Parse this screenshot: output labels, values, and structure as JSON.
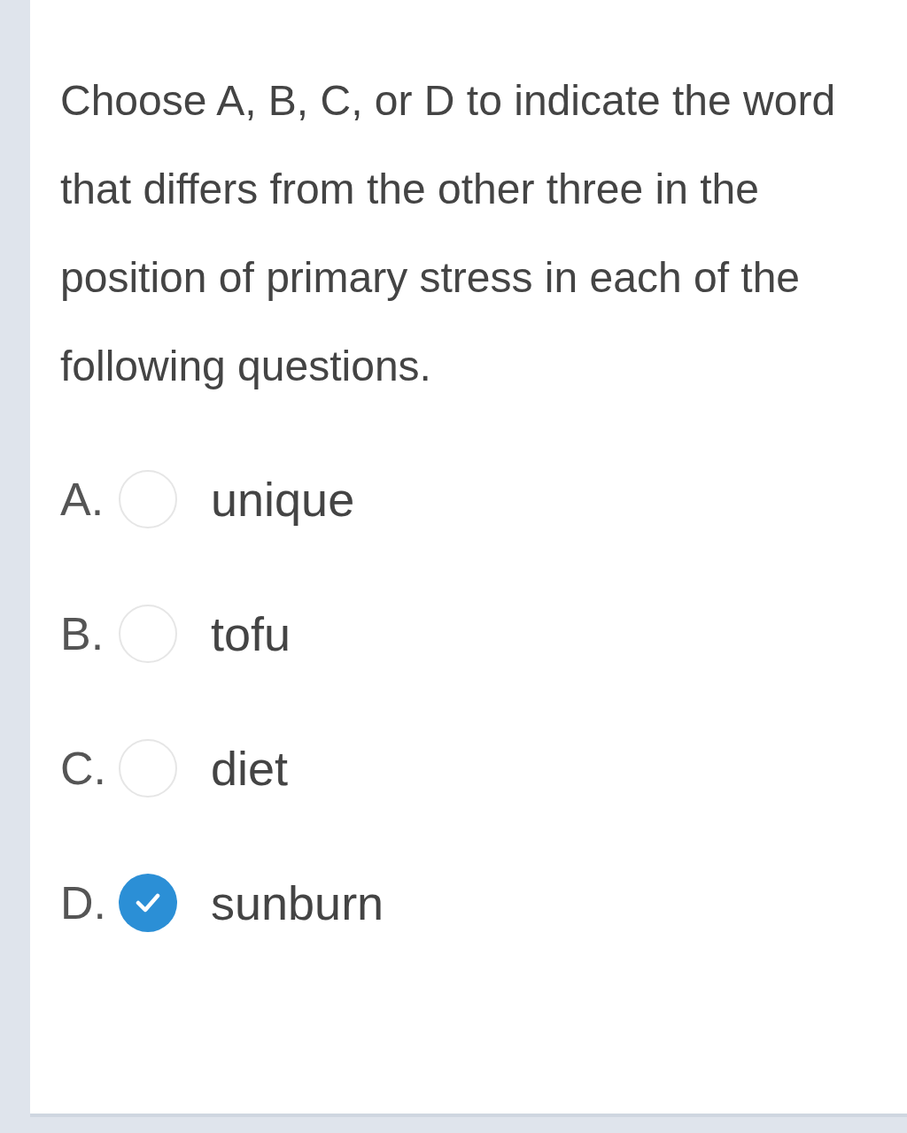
{
  "question": "Choose A, B, C, or D to indicate the word that differs from the other three in the position of primary stress in each of the following questions.",
  "options": [
    {
      "letter": "A.",
      "text": "unique",
      "selected": false
    },
    {
      "letter": "B.",
      "text": "tofu",
      "selected": false
    },
    {
      "letter": "C.",
      "text": "diet",
      "selected": false
    },
    {
      "letter": "D.",
      "text": "sunburn",
      "selected": true
    }
  ]
}
